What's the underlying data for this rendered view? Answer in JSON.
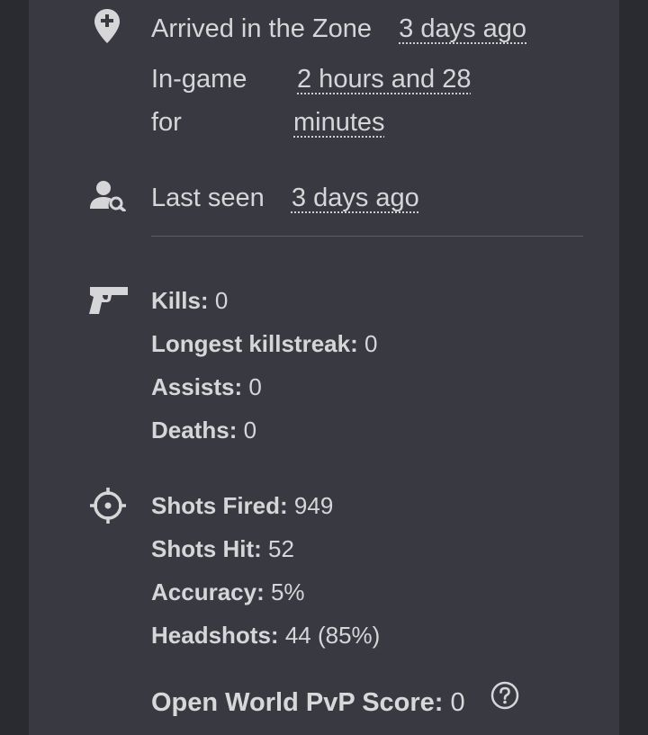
{
  "profile": {
    "arrived": {
      "label": "Arrived in the Zone",
      "value": "3 days ago"
    },
    "ingame": {
      "label_line1": "In-game",
      "label_line2": "for",
      "value_line1": "2 hours and 28",
      "value_line2": "minutes"
    },
    "last_seen": {
      "label": "Last seen",
      "value": "3 days ago"
    }
  },
  "combat": {
    "kills": {
      "label": "Kills:",
      "value": "0"
    },
    "longest_killstreak": {
      "label": "Longest killstreak:",
      "value": "0"
    },
    "assists": {
      "label": "Assists:",
      "value": "0"
    },
    "deaths": {
      "label": "Deaths:",
      "value": "0"
    }
  },
  "shooting": {
    "shots_fired": {
      "label": "Shots Fired:",
      "value": "949"
    },
    "shots_hit": {
      "label": "Shots Hit:",
      "value": "52"
    },
    "accuracy": {
      "label": "Accuracy:",
      "value": "5%"
    },
    "headshots": {
      "label": "Headshots:",
      "value": "44 (85%)"
    }
  },
  "pvp": {
    "label": "Open World PvP Score:",
    "value": "0"
  },
  "colors": {
    "background": "#2a2b30",
    "card": "#393a41",
    "text": "#d6d6d9"
  },
  "icons": [
    "map-pin-plus-icon",
    "user-search-icon",
    "pistol-icon",
    "crosshair-icon",
    "help-circle-icon"
  ]
}
